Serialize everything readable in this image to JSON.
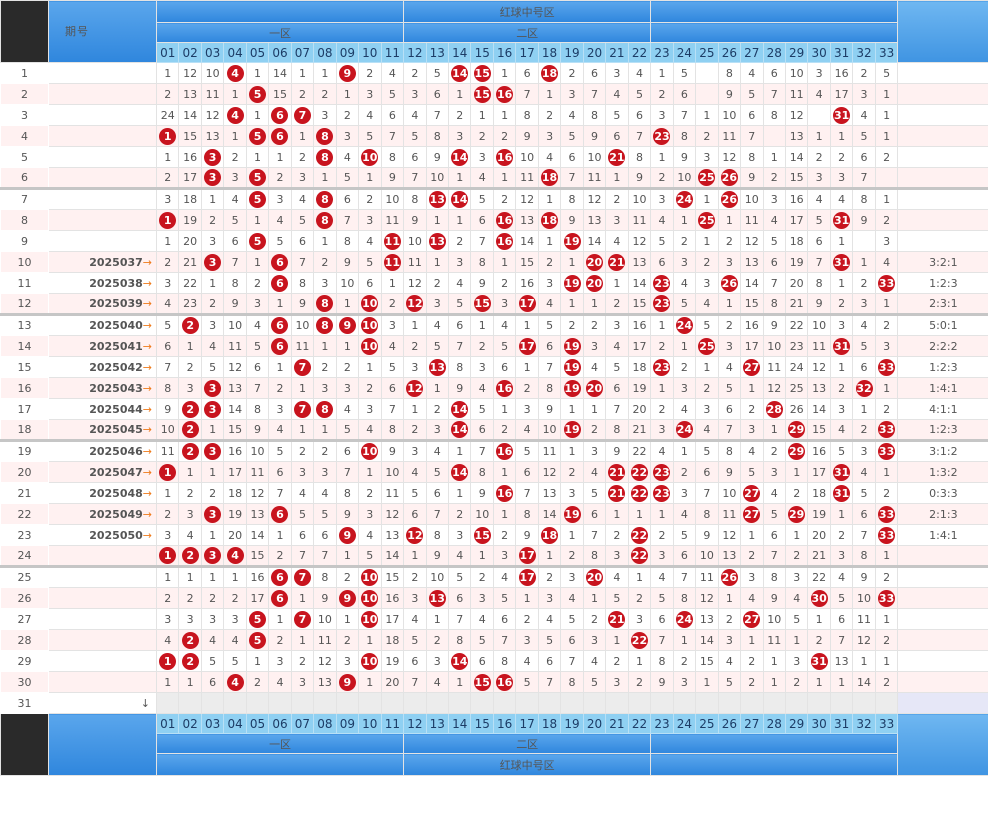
{
  "header": {
    "period_label": "期号",
    "section_title": "红球中号区",
    "zone1": "一区",
    "zone2": "二区",
    "columns": [
      "01",
      "02",
      "03",
      "04",
      "05",
      "06",
      "07",
      "08",
      "09",
      "10",
      "11",
      "12",
      "13",
      "14",
      "15",
      "16",
      "17",
      "18",
      "19",
      "20",
      "21",
      "22",
      "23",
      "24",
      "25",
      "26",
      "27",
      "28",
      "29",
      "30",
      "31",
      "32",
      "33"
    ]
  },
  "rows": [
    {
      "n": 1,
      "p": "",
      "r": "",
      "sep": false,
      "v": [
        "1",
        "12",
        "10",
        "B4",
        "1",
        "14",
        "1",
        "1",
        "B9",
        "2",
        "4",
        "2",
        "5",
        "B14",
        "B15",
        "1",
        "6",
        "B18",
        "2",
        "6",
        "3",
        "4",
        "1",
        "5",
        "",
        "8",
        "4",
        "6",
        "10",
        "3",
        "16",
        "2",
        "5"
      ]
    },
    {
      "n": 2,
      "p": "",
      "r": "",
      "sep": false,
      "v": [
        "2",
        "13",
        "11",
        "1",
        "B5",
        "15",
        "2",
        "2",
        "1",
        "3",
        "5",
        "3",
        "6",
        "1",
        "B15",
        "B16",
        "7",
        "1",
        "3",
        "7",
        "4",
        "5",
        "2",
        "6",
        "",
        "9",
        "5",
        "7",
        "11",
        "4",
        "17",
        "3",
        "1"
      ]
    },
    {
      "n": 3,
      "p": "",
      "r": "",
      "sep": false,
      "v": [
        "24",
        "14",
        "12",
        "B4",
        "1",
        "B6",
        "B7",
        "3",
        "2",
        "4",
        "6",
        "4",
        "7",
        "2",
        "1",
        "1",
        "8",
        "2",
        "4",
        "8",
        "5",
        "6",
        "3",
        "7",
        "1",
        "10",
        "6",
        "8",
        "12",
        "",
        "B31",
        "4",
        "1"
      ]
    },
    {
      "n": 4,
      "p": "",
      "r": "",
      "sep": false,
      "v": [
        "B1",
        "15",
        "13",
        "1",
        "B5",
        "B6",
        "1",
        "B8",
        "3",
        "5",
        "7",
        "5",
        "8",
        "3",
        "2",
        "2",
        "9",
        "3",
        "5",
        "9",
        "6",
        "7",
        "B23",
        "8",
        "2",
        "11",
        "7",
        "",
        "13",
        "1",
        "1",
        "5",
        "1"
      ]
    },
    {
      "n": 5,
      "p": "",
      "r": "",
      "sep": false,
      "v": [
        "1",
        "16",
        "B3",
        "2",
        "1",
        "1",
        "2",
        "B8",
        "4",
        "B10",
        "8",
        "6",
        "9",
        "B14",
        "3",
        "B16",
        "10",
        "4",
        "6",
        "10",
        "B21",
        "8",
        "1",
        "9",
        "3",
        "12",
        "8",
        "1",
        "14",
        "2",
        "2",
        "6",
        "2"
      ]
    },
    {
      "n": 6,
      "p": "",
      "r": "",
      "sep": false,
      "v": [
        "2",
        "17",
        "B3",
        "3",
        "B5",
        "2",
        "3",
        "1",
        "5",
        "1",
        "9",
        "7",
        "10",
        "1",
        "4",
        "1",
        "11",
        "B18",
        "7",
        "11",
        "1",
        "9",
        "2",
        "10",
        "B25",
        "B26",
        "9",
        "2",
        "15",
        "3",
        "3",
        "7",
        ""
      ]
    },
    {
      "n": 7,
      "p": "",
      "r": "",
      "sep": true,
      "v": [
        "3",
        "18",
        "1",
        "4",
        "B5",
        "3",
        "4",
        "B8",
        "6",
        "2",
        "10",
        "8",
        "B13",
        "B14",
        "5",
        "2",
        "12",
        "1",
        "8",
        "12",
        "2",
        "10",
        "3",
        "B24",
        "1",
        "B26",
        "10",
        "3",
        "16",
        "4",
        "4",
        "8",
        "1"
      ]
    },
    {
      "n": 8,
      "p": "",
      "r": "",
      "sep": false,
      "v": [
        "B1",
        "19",
        "2",
        "5",
        "1",
        "4",
        "5",
        "B8",
        "7",
        "3",
        "11",
        "9",
        "1",
        "1",
        "6",
        "B16",
        "13",
        "B18",
        "9",
        "13",
        "3",
        "11",
        "4",
        "1",
        "B25",
        "1",
        "11",
        "4",
        "17",
        "5",
        "B31",
        "9",
        "2"
      ]
    },
    {
      "n": 9,
      "p": "",
      "r": "",
      "sep": false,
      "v": [
        "1",
        "20",
        "3",
        "6",
        "B5",
        "5",
        "6",
        "1",
        "8",
        "4",
        "B11",
        "10",
        "B13",
        "2",
        "7",
        "B16",
        "14",
        "1",
        "B19",
        "14",
        "4",
        "12",
        "5",
        "2",
        "1",
        "2",
        "12",
        "5",
        "18",
        "6",
        "1",
        "",
        "3"
      ]
    },
    {
      "n": 10,
      "p": "2025037",
      "r": "3:2:1",
      "sep": false,
      "v": [
        "2",
        "21",
        "B3",
        "7",
        "1",
        "B6",
        "7",
        "2",
        "9",
        "5",
        "B11",
        "11",
        "1",
        "3",
        "8",
        "1",
        "15",
        "2",
        "1",
        "B20",
        "B21",
        "13",
        "6",
        "3",
        "2",
        "3",
        "13",
        "6",
        "19",
        "7",
        "B31",
        "1",
        "4"
      ]
    },
    {
      "n": 11,
      "p": "2025038",
      "r": "1:2:3",
      "sep": false,
      "v": [
        "3",
        "22",
        "1",
        "8",
        "2",
        "B6",
        "8",
        "3",
        "10",
        "6",
        "1",
        "12",
        "2",
        "4",
        "9",
        "2",
        "16",
        "3",
        "B19",
        "B20",
        "1",
        "14",
        "B23",
        "4",
        "3",
        "B26",
        "14",
        "7",
        "20",
        "8",
        "1",
        "2",
        "B33"
      ]
    },
    {
      "n": 12,
      "p": "2025039",
      "r": "2:3:1",
      "sep": false,
      "v": [
        "4",
        "23",
        "2",
        "9",
        "3",
        "1",
        "9",
        "B8",
        "1",
        "B10",
        "2",
        "B12",
        "3",
        "5",
        "B15",
        "3",
        "B17",
        "4",
        "1",
        "1",
        "2",
        "15",
        "B23",
        "5",
        "4",
        "1",
        "15",
        "8",
        "21",
        "9",
        "2",
        "3",
        "1"
      ]
    },
    {
      "n": 13,
      "p": "2025040",
      "r": "5:0:1",
      "sep": true,
      "v": [
        "5",
        "B2",
        "3",
        "10",
        "4",
        "B6",
        "10",
        "B8",
        "B9",
        "B10",
        "3",
        "1",
        "4",
        "6",
        "1",
        "4",
        "1",
        "5",
        "2",
        "2",
        "3",
        "16",
        "1",
        "B24",
        "5",
        "2",
        "16",
        "9",
        "22",
        "10",
        "3",
        "4",
        "2"
      ]
    },
    {
      "n": 14,
      "p": "2025041",
      "r": "2:2:2",
      "sep": false,
      "v": [
        "6",
        "1",
        "4",
        "11",
        "5",
        "B6",
        "11",
        "1",
        "1",
        "B10",
        "4",
        "2",
        "5",
        "7",
        "2",
        "5",
        "B17",
        "6",
        "B19",
        "3",
        "4",
        "17",
        "2",
        "1",
        "B25",
        "3",
        "17",
        "10",
        "23",
        "11",
        "B31",
        "5",
        "3"
      ]
    },
    {
      "n": 15,
      "p": "2025042",
      "r": "1:2:3",
      "sep": false,
      "v": [
        "7",
        "2",
        "5",
        "12",
        "6",
        "1",
        "B7",
        "2",
        "2",
        "1",
        "5",
        "3",
        "B13",
        "8",
        "3",
        "6",
        "1",
        "7",
        "B19",
        "4",
        "5",
        "18",
        "B23",
        "2",
        "1",
        "4",
        "B27",
        "11",
        "24",
        "12",
        "1",
        "6",
        "B33"
      ]
    },
    {
      "n": 16,
      "p": "2025043",
      "r": "1:4:1",
      "sep": false,
      "v": [
        "8",
        "3",
        "B3",
        "13",
        "7",
        "2",
        "1",
        "3",
        "3",
        "2",
        "6",
        "B12",
        "1",
        "9",
        "4",
        "B16",
        "2",
        "8",
        "B19",
        "B20",
        "6",
        "19",
        "1",
        "3",
        "2",
        "5",
        "1",
        "12",
        "25",
        "13",
        "2",
        "B32",
        "1"
      ]
    },
    {
      "n": 17,
      "p": "2025044",
      "r": "4:1:1",
      "sep": false,
      "v": [
        "9",
        "B2",
        "B3",
        "14",
        "8",
        "3",
        "B7",
        "B8",
        "4",
        "3",
        "7",
        "1",
        "2",
        "B14",
        "5",
        "1",
        "3",
        "9",
        "1",
        "1",
        "7",
        "20",
        "2",
        "4",
        "3",
        "6",
        "2",
        "B28",
        "26",
        "14",
        "3",
        "1",
        "2"
      ]
    },
    {
      "n": 18,
      "p": "2025045",
      "r": "1:2:3",
      "sep": false,
      "v": [
        "10",
        "B2",
        "1",
        "15",
        "9",
        "4",
        "1",
        "1",
        "5",
        "4",
        "8",
        "2",
        "3",
        "B14",
        "6",
        "2",
        "4",
        "10",
        "B19",
        "2",
        "8",
        "21",
        "3",
        "B24",
        "4",
        "7",
        "3",
        "1",
        "B29",
        "15",
        "4",
        "2",
        "B33"
      ]
    },
    {
      "n": 19,
      "p": "2025046",
      "r": "3:1:2",
      "sep": true,
      "v": [
        "11",
        "B2",
        "B3",
        "16",
        "10",
        "5",
        "2",
        "2",
        "6",
        "B10",
        "9",
        "3",
        "4",
        "1",
        "7",
        "B16",
        "5",
        "11",
        "1",
        "3",
        "9",
        "22",
        "4",
        "1",
        "5",
        "8",
        "4",
        "2",
        "B29",
        "16",
        "5",
        "3",
        "B33"
      ]
    },
    {
      "n": 20,
      "p": "2025047",
      "r": "1:3:2",
      "sep": false,
      "v": [
        "B1",
        "1",
        "1",
        "17",
        "11",
        "6",
        "3",
        "3",
        "7",
        "1",
        "10",
        "4",
        "5",
        "B14",
        "8",
        "1",
        "6",
        "12",
        "2",
        "4",
        "B21",
        "B22",
        "B23",
        "2",
        "6",
        "9",
        "5",
        "3",
        "1",
        "17",
        "B31",
        "4",
        "1"
      ]
    },
    {
      "n": 21,
      "p": "2025048",
      "r": "0:3:3",
      "sep": false,
      "v": [
        "1",
        "2",
        "2",
        "18",
        "12",
        "7",
        "4",
        "4",
        "8",
        "2",
        "11",
        "5",
        "6",
        "1",
        "9",
        "B16",
        "7",
        "13",
        "3",
        "5",
        "B21",
        "B22",
        "B23",
        "3",
        "7",
        "10",
        "B27",
        "4",
        "2",
        "18",
        "B31",
        "5",
        "2"
      ]
    },
    {
      "n": 22,
      "p": "2025049",
      "r": "2:1:3",
      "sep": false,
      "v": [
        "2",
        "3",
        "B3",
        "19",
        "13",
        "B6",
        "5",
        "5",
        "9",
        "3",
        "12",
        "6",
        "7",
        "2",
        "10",
        "1",
        "8",
        "14",
        "B19",
        "6",
        "1",
        "1",
        "1",
        "4",
        "8",
        "11",
        "B27",
        "5",
        "B29",
        "19",
        "1",
        "6",
        "B33"
      ]
    },
    {
      "n": 23,
      "p": "2025050",
      "r": "1:4:1",
      "sep": false,
      "v": [
        "3",
        "4",
        "1",
        "20",
        "14",
        "1",
        "6",
        "6",
        "B9",
        "4",
        "13",
        "B12",
        "8",
        "3",
        "B15",
        "2",
        "9",
        "B18",
        "1",
        "7",
        "2",
        "B22",
        "2",
        "5",
        "9",
        "12",
        "1",
        "6",
        "1",
        "20",
        "2",
        "7",
        "B33"
      ]
    },
    {
      "n": 24,
      "p": "",
      "r": "",
      "sep": false,
      "v": [
        "B1",
        "B2",
        "B3",
        "B4",
        "15",
        "2",
        "7",
        "7",
        "1",
        "5",
        "14",
        "1",
        "9",
        "4",
        "1",
        "3",
        "B17",
        "1",
        "2",
        "8",
        "3",
        "B22",
        "3",
        "6",
        "10",
        "13",
        "2",
        "7",
        "2",
        "21",
        "3",
        "8",
        "1"
      ]
    },
    {
      "n": 25,
      "p": "",
      "r": "",
      "sep": true,
      "v": [
        "1",
        "1",
        "1",
        "1",
        "16",
        "B6",
        "B7",
        "8",
        "2",
        "B10",
        "15",
        "2",
        "10",
        "5",
        "2",
        "4",
        "B17",
        "2",
        "3",
        "B20",
        "4",
        "1",
        "4",
        "7",
        "11",
        "B26",
        "3",
        "8",
        "3",
        "22",
        "4",
        "9",
        "2"
      ]
    },
    {
      "n": 26,
      "p": "",
      "r": "",
      "sep": false,
      "v": [
        "2",
        "2",
        "2",
        "2",
        "17",
        "B6",
        "1",
        "9",
        "B9",
        "B10",
        "16",
        "3",
        "B13",
        "6",
        "3",
        "5",
        "1",
        "3",
        "4",
        "1",
        "5",
        "2",
        "5",
        "8",
        "12",
        "1",
        "4",
        "9",
        "4",
        "B30",
        "5",
        "10",
        "B33"
      ]
    },
    {
      "n": 27,
      "p": "",
      "r": "",
      "sep": false,
      "v": [
        "3",
        "3",
        "3",
        "3",
        "B5",
        "1",
        "B7",
        "10",
        "1",
        "B10",
        "17",
        "4",
        "1",
        "7",
        "4",
        "6",
        "2",
        "4",
        "5",
        "2",
        "B21",
        "3",
        "6",
        "B24",
        "13",
        "2",
        "B27",
        "10",
        "5",
        "1",
        "6",
        "11",
        "1"
      ]
    },
    {
      "n": 28,
      "p": "",
      "r": "",
      "sep": false,
      "v": [
        "4",
        "B2",
        "4",
        "4",
        "B5",
        "2",
        "1",
        "11",
        "2",
        "1",
        "18",
        "5",
        "2",
        "8",
        "5",
        "7",
        "3",
        "5",
        "6",
        "3",
        "1",
        "B22",
        "7",
        "1",
        "14",
        "3",
        "1",
        "11",
        "1",
        "2",
        "7",
        "12",
        "2"
      ]
    },
    {
      "n": 29,
      "p": "",
      "r": "",
      "sep": false,
      "v": [
        "B1",
        "B2",
        "5",
        "5",
        "1",
        "3",
        "2",
        "12",
        "3",
        "B10",
        "19",
        "6",
        "3",
        "B14",
        "6",
        "8",
        "4",
        "6",
        "7",
        "4",
        "2",
        "1",
        "8",
        "2",
        "15",
        "4",
        "2",
        "1",
        "3",
        "B31",
        "13",
        "1",
        "1"
      ]
    },
    {
      "n": 30,
      "p": "",
      "r": "",
      "sep": false,
      "v": [
        "1",
        "1",
        "6",
        "B4",
        "2",
        "4",
        "3",
        "13",
        "B9",
        "1",
        "20",
        "7",
        "4",
        "1",
        "B15",
        "B16",
        "5",
        "7",
        "8",
        "5",
        "3",
        "2",
        "9",
        "3",
        "1",
        "5",
        "2",
        "1",
        "2",
        "1",
        "1",
        "14",
        "2"
      ]
    },
    {
      "n": 31,
      "p": "",
      "r": "",
      "sep": false,
      "v": [
        "",
        "",
        "",
        "",
        "",
        "",
        "",
        "",
        "",
        "",
        "",
        "",
        "",
        "",
        "",
        "",
        "",
        "",
        "",
        "",
        "",
        "",
        "",
        "",
        "",
        "",
        "",
        "",
        "",
        "",
        "",
        "",
        ""
      ]
    }
  ],
  "footer": {
    "arrow": "↓"
  }
}
